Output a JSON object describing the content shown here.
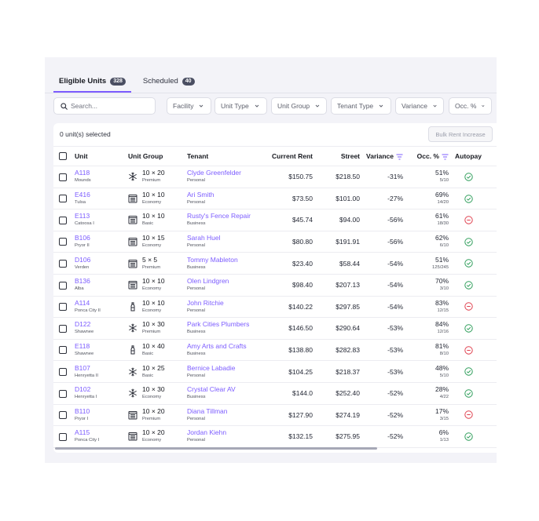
{
  "tabs": [
    {
      "label": "Eligible Units",
      "count": "328"
    },
    {
      "label": "Scheduled",
      "count": "40"
    }
  ],
  "search": {
    "placeholder": "Search..."
  },
  "filters": [
    "Facility",
    "Unit Type",
    "Unit Group",
    "Tenant Type",
    "Variance",
    "Occ. %"
  ],
  "selection": {
    "text": "0 unit(s) selected",
    "bulk_label": "Bulk Rent Increase"
  },
  "columns": {
    "unit": "Unit",
    "unit_group": "Unit Group",
    "tenant": "Tenant",
    "current_rent": "Current Rent",
    "street": "Street",
    "variance": "Variance",
    "occupancy": "Occ. %",
    "autopay": "Autopay"
  },
  "colors": {
    "accent": "#7c5cff",
    "autopay_on": "#2f9e5b",
    "autopay_off": "#e0414f"
  },
  "rows": [
    {
      "unit": "A118",
      "facility": "Mounds",
      "group_icon": "snowflake-icon",
      "size": "10 × 20",
      "group": "Premium",
      "tenant": "Clyde Greenfelder",
      "tenant_type": "Personal",
      "current_rent": "$150.75",
      "street": "$218.50",
      "variance": "-31%",
      "occ": "51%",
      "occ_frac": "5/10",
      "autopay": "on"
    },
    {
      "unit": "E416",
      "facility": "Tulsa",
      "group_icon": "storage-unit-icon",
      "size": "10 × 10",
      "group": "Economy",
      "tenant": "Ari Smith",
      "tenant_type": "Personal",
      "current_rent": "$73.50",
      "street": "$101.00",
      "variance": "-27%",
      "occ": "69%",
      "occ_frac": "14/20",
      "autopay": "on"
    },
    {
      "unit": "E113",
      "facility": "Catoosa I",
      "group_icon": "storage-unit-icon",
      "size": "10 × 10",
      "group": "Basic",
      "tenant": "Rusty's Fence Repair",
      "tenant_type": "Business",
      "current_rent": "$45.74",
      "street": "$94.00",
      "variance": "-56%",
      "occ": "61%",
      "occ_frac": "18/30",
      "autopay": "off"
    },
    {
      "unit": "B106",
      "facility": "Pryor II",
      "group_icon": "storage-unit-icon",
      "size": "10 × 15",
      "group": "Economy",
      "tenant": "Sarah Huel",
      "tenant_type": "Personal",
      "current_rent": "$80.80",
      "street": "$191.91",
      "variance": "-56%",
      "occ": "62%",
      "occ_frac": "6/10",
      "autopay": "on"
    },
    {
      "unit": "D106",
      "facility": "Verden",
      "group_icon": "storage-unit-icon",
      "size": "5 × 5",
      "group": "Premium",
      "tenant": "Tommy Mableton",
      "tenant_type": "Business",
      "current_rent": "$23.40",
      "street": "$58.44",
      "variance": "-54%",
      "occ": "51%",
      "occ_frac": "125/245",
      "autopay": "on"
    },
    {
      "unit": "B136",
      "facility": "Alba",
      "group_icon": "storage-unit-icon",
      "size": "10 × 10",
      "group": "Economy",
      "tenant": "Olen Lindgren",
      "tenant_type": "Personal",
      "current_rent": "$98.40",
      "street": "$207.13",
      "variance": "-54%",
      "occ": "70%",
      "occ_frac": "3/10",
      "autopay": "on"
    },
    {
      "unit": "A114",
      "facility": "Ponca City II",
      "group_icon": "bottle-icon",
      "size": "10 × 10",
      "group": "Economy",
      "tenant": "John Ritchie",
      "tenant_type": "Personal",
      "current_rent": "$140.22",
      "street": "$297.85",
      "variance": "-54%",
      "occ": "83%",
      "occ_frac": "12/15",
      "autopay": "off"
    },
    {
      "unit": "D122",
      "facility": "Shawnee",
      "group_icon": "snowflake-icon",
      "size": "10 × 30",
      "group": "Premium",
      "tenant": "Park Cities Plumbers",
      "tenant_type": "Business",
      "current_rent": "$146.50",
      "street": "$290.64",
      "variance": "-53%",
      "occ": "84%",
      "occ_frac": "12/16",
      "autopay": "on"
    },
    {
      "unit": "E118",
      "facility": "Shawnee",
      "group_icon": "bottle-icon",
      "size": "10 × 40",
      "group": "Basic",
      "tenant": "Amy Arts and Crafts",
      "tenant_type": "Business",
      "current_rent": "$138.80",
      "street": "$282.83",
      "variance": "-53%",
      "occ": "81%",
      "occ_frac": "8/10",
      "autopay": "off"
    },
    {
      "unit": "B107",
      "facility": "Henryetta II",
      "group_icon": "snowflake-icon",
      "size": "10 × 25",
      "group": "Basic",
      "tenant": "Bernice Labadie",
      "tenant_type": "Personal",
      "current_rent": "$104.25",
      "street": "$218.37",
      "variance": "-53%",
      "occ": "48%",
      "occ_frac": "5/10",
      "autopay": "on"
    },
    {
      "unit": "D102",
      "facility": "Henryetta I",
      "group_icon": "snowflake-icon",
      "size": "10 × 30",
      "group": "Economy",
      "tenant": "Crystal Clear AV",
      "tenant_type": "Business",
      "current_rent": "$144.0",
      "street": "$252.40",
      "variance": "-52%",
      "occ": "28%",
      "occ_frac": "4/22",
      "autopay": "on"
    },
    {
      "unit": "B110",
      "facility": "Pryor I",
      "group_icon": "storage-unit-icon",
      "size": "10 × 20",
      "group": "Premium",
      "tenant": "Diana Tillman",
      "tenant_type": "Personal",
      "current_rent": "$127.90",
      "street": "$274.19",
      "variance": "-52%",
      "occ": "17%",
      "occ_frac": "3/15",
      "autopay": "off"
    },
    {
      "unit": "A115",
      "facility": "Ponca City I",
      "group_icon": "storage-unit-icon",
      "size": "10 × 20",
      "group": "Economy",
      "tenant": "Jordan Kiehn",
      "tenant_type": "Personal",
      "current_rent": "$132.15",
      "street": "$275.95",
      "variance": "-52%",
      "occ": "6%",
      "occ_frac": "1/13",
      "autopay": "on"
    }
  ]
}
